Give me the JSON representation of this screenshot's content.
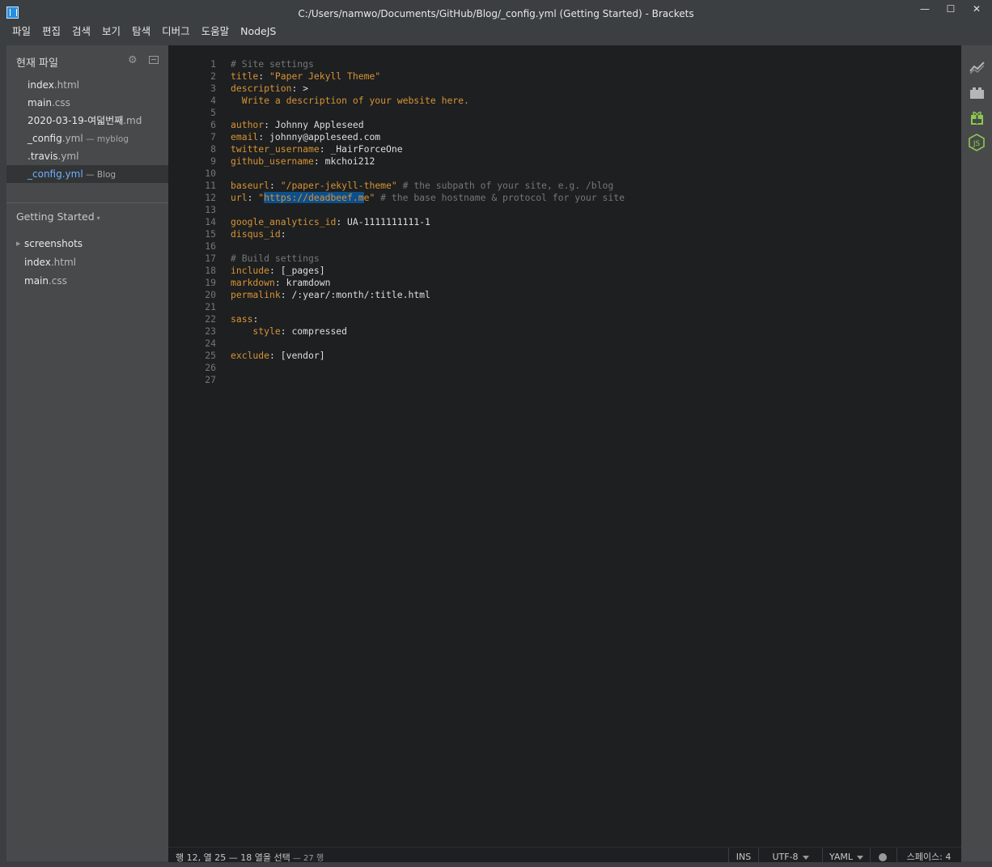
{
  "window": {
    "title": "C:/Users/namwo/Documents/GitHub/Blog/_config.yml (Getting Started) - Brackets",
    "minimize": "—",
    "maximize": "☐",
    "close": "✕"
  },
  "menu": [
    "파일",
    "편집",
    "검색",
    "보기",
    "탐색",
    "디버그",
    "도움말",
    "NodeJS"
  ],
  "working_files": {
    "header": "현재 파일",
    "items": [
      {
        "base": "index",
        "ext": ".html",
        "dir": ""
      },
      {
        "base": "main",
        "ext": ".css",
        "dir": ""
      },
      {
        "base": "2020-03-19-여덟번째",
        "ext": ".md",
        "dir": ""
      },
      {
        "base": "_config",
        "ext": ".yml",
        "dir": " — myblog"
      },
      {
        "base": ".travis",
        "ext": ".yml",
        "dir": ""
      },
      {
        "base": "_config",
        "ext": ".yml",
        "dir": " — Blog"
      }
    ]
  },
  "project": {
    "title": "Getting Started",
    "caret": "▾",
    "folder": {
      "name": "screenshots",
      "arrow": "▶"
    },
    "files": [
      {
        "base": "index",
        "ext": ".html"
      },
      {
        "base": "main",
        "ext": ".css"
      }
    ]
  },
  "editor": {
    "line_numbers": [
      "1",
      "2",
      "3",
      "4",
      "5",
      "6",
      "7",
      "8",
      "9",
      "10",
      "11",
      "12",
      "13",
      "14",
      "15",
      "16",
      "17",
      "18",
      "19",
      "20",
      "21",
      "22",
      "23",
      "24",
      "25",
      "26",
      "27"
    ],
    "lines": [
      [
        {
          "t": "# Site settings",
          "c": "cm"
        }
      ],
      [
        {
          "t": "title",
          "c": "k"
        },
        {
          "t": ": ",
          "c": "p"
        },
        {
          "t": "\"Paper Jekyll Theme\"",
          "c": "s"
        }
      ],
      [
        {
          "t": "description",
          "c": "k"
        },
        {
          "t": ": >",
          "c": "p"
        }
      ],
      [
        {
          "t": "  Write a description of your website here.",
          "c": "s"
        }
      ],
      [],
      [
        {
          "t": "author",
          "c": "k"
        },
        {
          "t": ": Johnny Appleseed",
          "c": "p"
        }
      ],
      [
        {
          "t": "email",
          "c": "k"
        },
        {
          "t": ": johnny@appleseed.com",
          "c": "p"
        }
      ],
      [
        {
          "t": "twitter_username",
          "c": "k"
        },
        {
          "t": ": _HairForceOne",
          "c": "p"
        }
      ],
      [
        {
          "t": "github_username",
          "c": "k"
        },
        {
          "t": ": mkchoi212",
          "c": "p"
        }
      ],
      [],
      [
        {
          "t": "baseurl",
          "c": "k"
        },
        {
          "t": ": ",
          "c": "p"
        },
        {
          "t": "\"/paper-jekyll-theme\"",
          "c": "s"
        },
        {
          "t": " # the subpath of your site, e.g. /blog",
          "c": "cm"
        }
      ],
      [
        {
          "t": "url",
          "c": "k"
        },
        {
          "t": ": ",
          "c": "p"
        },
        {
          "t": "\"",
          "c": "s"
        },
        {
          "t": "https://deadbeef.m",
          "c": "sel"
        },
        {
          "t": "e\"",
          "c": "s"
        },
        {
          "t": " # the base hostname & protocol for your site",
          "c": "cm"
        }
      ],
      [],
      [
        {
          "t": "google_analytics_id",
          "c": "k"
        },
        {
          "t": ": UA-1111111111-1",
          "c": "p"
        }
      ],
      [
        {
          "t": "disqus_id",
          "c": "k"
        },
        {
          "t": ":",
          "c": "p"
        }
      ],
      [],
      [
        {
          "t": "# Build settings",
          "c": "cm"
        }
      ],
      [
        {
          "t": "include",
          "c": "k"
        },
        {
          "t": ": [_pages]",
          "c": "p"
        }
      ],
      [
        {
          "t": "markdown",
          "c": "k"
        },
        {
          "t": ": kramdown",
          "c": "p"
        }
      ],
      [
        {
          "t": "permalink",
          "c": "k"
        },
        {
          "t": ": /:year/:month/:title.html",
          "c": "p"
        }
      ],
      [],
      [
        {
          "t": "sass",
          "c": "k"
        },
        {
          "t": ":",
          "c": "p"
        }
      ],
      [
        {
          "t": "    style",
          "c": "k"
        },
        {
          "t": ": compressed",
          "c": "p"
        }
      ],
      [],
      [
        {
          "t": "exclude",
          "c": "k"
        },
        {
          "t": ": [vendor]",
          "c": "p"
        }
      ],
      [],
      []
    ]
  },
  "status": {
    "cursor": "행 12, 열 25 — 18 열을 선택",
    "lines_count": " — 27 행",
    "mode": "INS",
    "encoding": "UTF-8",
    "language": "YAML",
    "indent": "스페이스: 4"
  },
  "colors": {
    "accent": "#6fb0ff",
    "keyword": "#d89333",
    "comment": "#767676",
    "selection": "#0d4f8b",
    "editor_bg": "#1d1f21",
    "sidebar_bg": "#47494b"
  },
  "toolbar_icons": [
    "live-preview-icon",
    "extension-manager-icon",
    "gift-icon",
    "nodejs-icon"
  ]
}
